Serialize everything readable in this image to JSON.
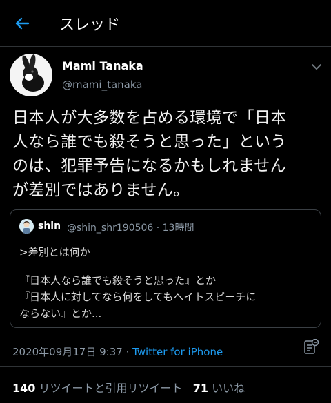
{
  "header": {
    "title": "スレッド"
  },
  "tweet": {
    "display_name": "Mami Tanaka",
    "handle": "@mami_tanaka",
    "lines": [
      "日本人が大多数を占める環境で「日本",
      "人なら誰でも殺そうと思った」という",
      "のは、犯罪予告になるかもしれません",
      "が差別ではありません。"
    ]
  },
  "quote": {
    "name": "shin",
    "meta": "@shin_shr190506 · 13時間",
    "lines": [
      ">差別とは何か",
      "『日本人なら誰でも殺そうと思った』とか",
      "『日本人に対してなら何をしてもヘイトスピーチに",
      "ならない』とか..."
    ]
  },
  "meta": {
    "timestamp": "2020年09月17日 9:37 · ",
    "source": "Twitter for iPhone"
  },
  "stats": {
    "retweets_count": "140",
    "retweets_label": "リツイートと引用リツイート",
    "likes_count": "71",
    "likes_label": "いいね"
  },
  "colors": {
    "accent": "#1d9bf0",
    "background": "#000000",
    "muted": "#8b98a5"
  },
  "icons": [
    "back-arrow-icon",
    "chevron-down-icon",
    "analytics-icon"
  ]
}
